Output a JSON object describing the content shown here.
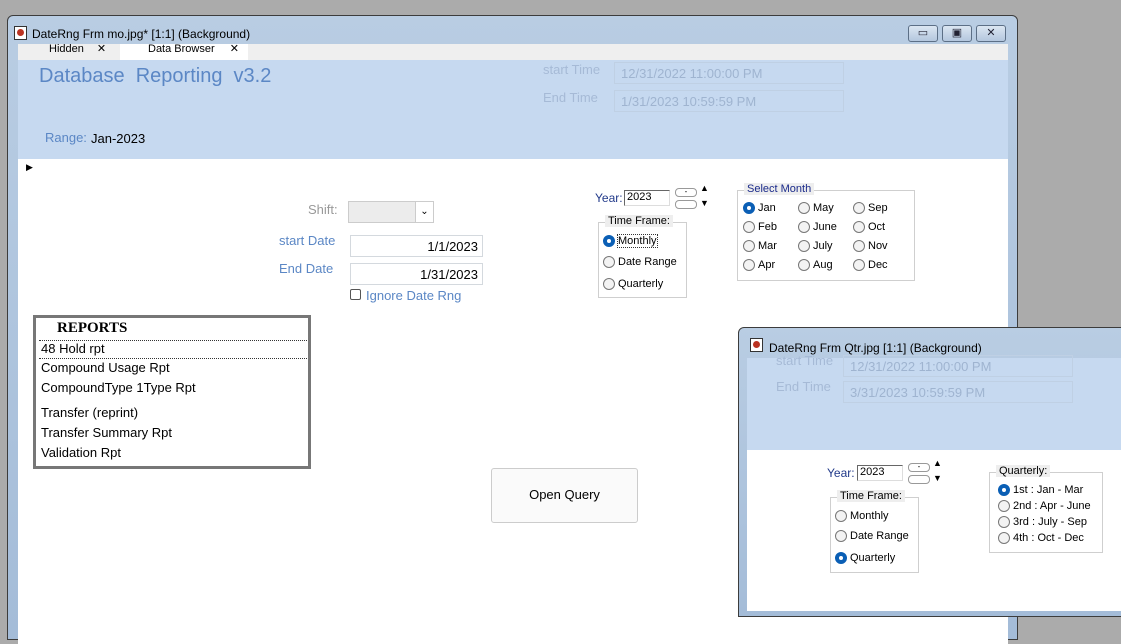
{
  "main_window": {
    "title": "DateRng Frm mo.jpg* [1:1] (Background)",
    "controls": {
      "minimize": "▭",
      "maximize": "▣",
      "close": "✕"
    },
    "tabs": [
      {
        "label": "Hidden"
      },
      {
        "label": "Data Browser"
      }
    ],
    "header": {
      "title": "Database  Reporting  v3.2",
      "start_time_label": "start Time",
      "start_time": "12/31/2022 11:00:00 PM",
      "end_time_label": "End Time",
      "end_time": "1/31/2023 10:59:59 PM",
      "range_label": "Range:",
      "range_value": "Jan-2023"
    },
    "shift_label": "Shift:",
    "start_date_label": "start Date",
    "start_date": "1/1/2023",
    "end_date_label": "End Date",
    "end_date": "1/31/2023",
    "ignore_date_label": "Ignore Date Rng",
    "year_label": "Year:",
    "year": "2023",
    "time_frame": {
      "legend": "Time Frame:",
      "options": [
        "Monthly",
        "Date Range",
        "Quarterly"
      ],
      "selected": "Monthly"
    },
    "select_month": {
      "legend": "Select Month",
      "months": [
        "Jan",
        "Feb",
        "Mar",
        "Apr",
        "May",
        "June",
        "July",
        "Aug",
        "Sep",
        "Oct",
        "Nov",
        "Dec"
      ],
      "selected": "Jan"
    },
    "reports": {
      "header": "REPORTS",
      "items": [
        "48 Hold rpt",
        "Compound Usage Rpt",
        "CompoundType 1Type Rpt",
        "Transfer  (reprint)",
        "Transfer Summary Rpt",
        "Validation Rpt"
      ]
    },
    "open_query_label": "Open Query"
  },
  "qtr_window": {
    "title": "DateRng Frm Qtr.jpg [1:1] (Background)",
    "start_time_label": "start Time",
    "start_time": "12/31/2022 11:00:00 PM",
    "end_time_label": "End Time",
    "end_time": "3/31/2023 10:59:59 PM",
    "year_label": "Year:",
    "year": "2023",
    "time_frame": {
      "legend": "Time Frame:",
      "options": [
        "Monthly",
        "Date Range",
        "Quarterly"
      ],
      "selected": "Quarterly"
    },
    "quarterly": {
      "legend": "Quarterly:",
      "options": [
        "1st  : Jan - Mar",
        "2nd : Apr - June",
        "3rd  : July - Sep",
        "4th  : Oct - Dec"
      ],
      "selected": "1st  : Jan - Mar"
    }
  }
}
